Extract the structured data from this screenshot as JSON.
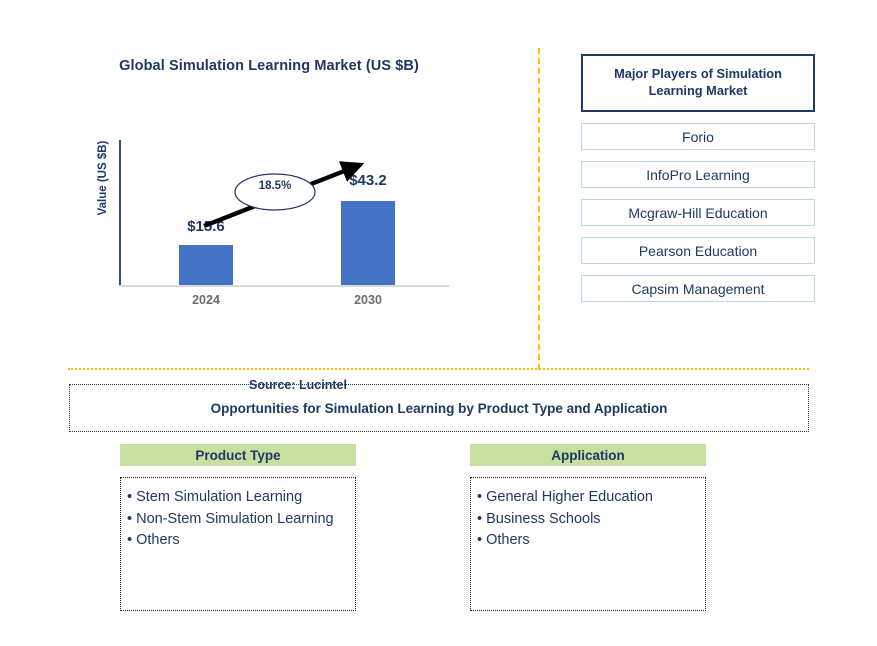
{
  "chart_panel": {
    "title": "Global Simulation Learning Market (US $B)",
    "source_note": "Source: Lucintel"
  },
  "chart_data": {
    "type": "bar",
    "title": "Global Simulation Learning Market (US $B)",
    "categories": [
      "2024",
      "2030"
    ],
    "values": [
      15.6,
      43.2
    ],
    "value_labels": [
      "$15.6",
      "$43.2"
    ],
    "xlabel": "",
    "ylabel": "Value (US $B)",
    "ylim": [
      0,
      50
    ],
    "grid": false,
    "legend": "none",
    "bar_color": "#4472C4",
    "annotations": [
      {
        "text": "18.5%",
        "kind": "cagr-callout",
        "shape": "ellipse-with-arrow",
        "from_category": "2024",
        "to_category": "2030"
      }
    ]
  },
  "players_panel": {
    "header": "Major Players of Simulation Learning Market",
    "items": [
      {
        "name": "Forio"
      },
      {
        "name": "InfoPro Learning"
      },
      {
        "name": "Mcgraw-Hill Education"
      },
      {
        "name": "Pearson Education"
      },
      {
        "name": "Capsim Management"
      }
    ]
  },
  "opportunities": {
    "banner": "Opportunities for Simulation Learning by Product Type and Application",
    "columns": [
      {
        "header": "Product Type",
        "items": [
          "Stem Simulation Learning",
          "Non-Stem Simulation Learning",
          "Others"
        ]
      },
      {
        "header": "Application",
        "items": [
          "General Higher Education",
          "Business Schools",
          "Others"
        ]
      }
    ]
  },
  "theme": {
    "navy": "#1F3864",
    "bar_blue": "#4472C4",
    "accent_orange": "#FFC000",
    "header_green": "#C6E0A0",
    "tick_gray": "#6B6B6B",
    "row_border_blue": "#BDD7EE"
  }
}
